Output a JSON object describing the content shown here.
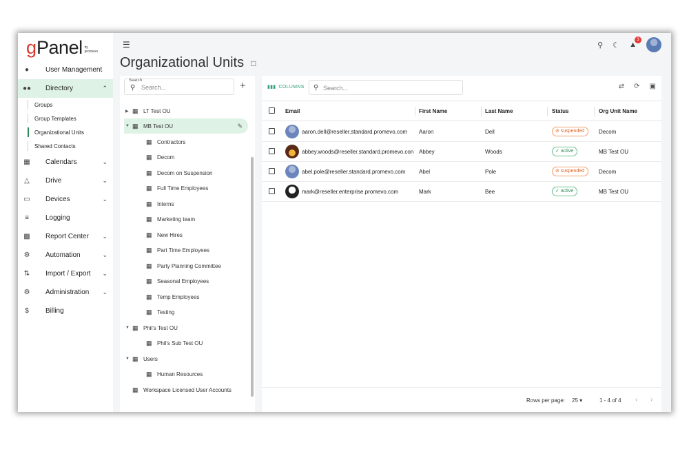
{
  "logo": {
    "g": "g",
    "rest": "Panel",
    "sub": "by promevo"
  },
  "nav": {
    "user_management": "User Management",
    "directory": "Directory",
    "sub": [
      "Groups",
      "Group Templates",
      "Organizational Units",
      "Shared Contacts"
    ],
    "calendars": "Calendars",
    "drive": "Drive",
    "devices": "Devices",
    "logging": "Logging",
    "report_center": "Report Center",
    "automation": "Automation",
    "import_export": "Import / Export",
    "administration": "Administration",
    "billing": "Billing"
  },
  "header": {
    "title": "Organizational Units",
    "notifications_count": "3"
  },
  "tree": {
    "search_label": "Search",
    "search_placeholder": "Search...",
    "items": [
      {
        "label": "LT Test OU"
      },
      {
        "label": "MB Test OU"
      },
      {
        "label": "Contractors"
      },
      {
        "label": "Decom"
      },
      {
        "label": "Decom on Suspension"
      },
      {
        "label": "Full Time Employees"
      },
      {
        "label": "Interns"
      },
      {
        "label": "Marketing team"
      },
      {
        "label": "New Hires"
      },
      {
        "label": "Part Time Employees"
      },
      {
        "label": "Party Planning Committee"
      },
      {
        "label": "Seasonal Employees"
      },
      {
        "label": "Temp Employees"
      },
      {
        "label": "Testing"
      },
      {
        "label": "Phil's Test OU"
      },
      {
        "label": "Phil's Sub Test OU"
      },
      {
        "label": "Users"
      },
      {
        "label": "Human Resources"
      },
      {
        "label": "Workspace Licensed User Accounts"
      }
    ]
  },
  "table": {
    "columns_label": "COLUMNS",
    "search_placeholder": "Search...",
    "headers": {
      "email": "Email",
      "first_name": "First Name",
      "last_name": "Last Name",
      "status": "Status",
      "org_unit": "Org Unit Name"
    },
    "rows": [
      {
        "email": "aaron.dell@reseller.standard.promevo.com",
        "first": "Aaron",
        "last": "Dell",
        "status": "suspended",
        "ou": "Decom"
      },
      {
        "email": "abbey.woods@reseller.standard.promevo.con",
        "first": "Abbey",
        "last": "Woods",
        "status": "active",
        "ou": "MB Test OU"
      },
      {
        "email": "abel.pole@reseller.standard.promevo.com",
        "first": "Abel",
        "last": "Pole",
        "status": "suspended",
        "ou": "Decom"
      },
      {
        "email": "mark@reseller.enterprise.promevo.com",
        "first": "Mark",
        "last": "Bee",
        "status": "active",
        "ou": "MB Test OU"
      }
    ],
    "footer": {
      "rows_per_page_label": "Rows per page:",
      "rows_per_page_value": "25",
      "range": "1 - 4 of 4"
    }
  },
  "colors": {
    "accent_green": "#2e8b57",
    "selected_bg": "#dff2e6",
    "logo_red": "#d83a2e",
    "suspended": "#e06020"
  }
}
